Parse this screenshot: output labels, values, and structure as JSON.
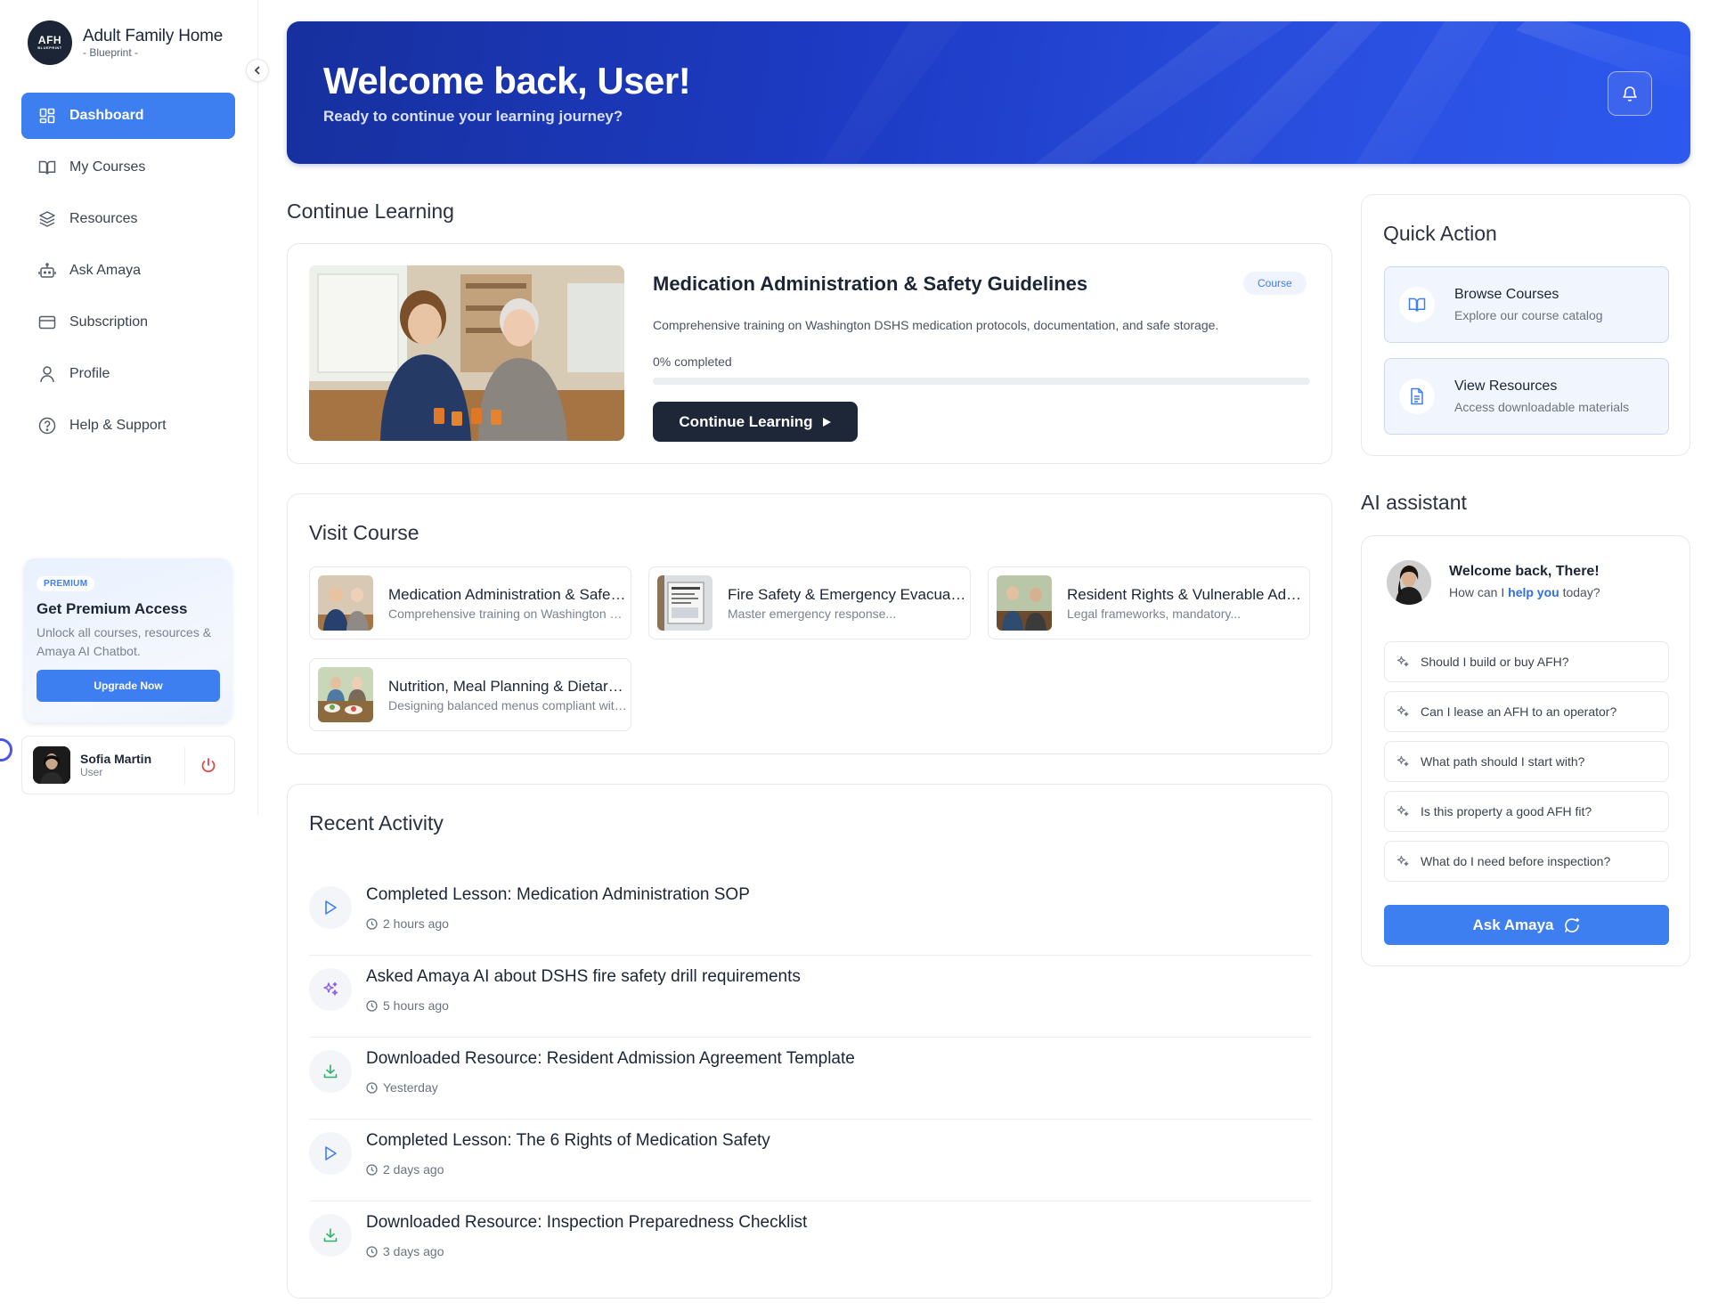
{
  "brand": {
    "logo_line1": "AFH",
    "logo_line2": "BLUEPRINT",
    "title": "Adult Family Home",
    "subtitle": "- Blueprint -"
  },
  "sidebar": {
    "items": [
      {
        "label": "Dashboard",
        "icon": "dashboard-icon",
        "active": true
      },
      {
        "label": "My Courses",
        "icon": "book-icon"
      },
      {
        "label": "Resources",
        "icon": "layers-icon"
      },
      {
        "label": "Ask Amaya",
        "icon": "bot-icon"
      },
      {
        "label": "Subscription",
        "icon": "card-icon"
      },
      {
        "label": "Profile",
        "icon": "user-icon"
      },
      {
        "label": "Help & Support",
        "icon": "help-icon"
      }
    ],
    "premium": {
      "tag": "PREMIUM",
      "title": "Get Premium Access",
      "desc": "Unlock all courses, resources & Amaya AI Chatbot.",
      "button": "Upgrade Now"
    },
    "user": {
      "name": "Sofia Martin",
      "role": "User"
    }
  },
  "hero": {
    "title": "Welcome back, User!",
    "subtitle": "Ready to continue your learning journey?"
  },
  "continue_learning": {
    "heading": "Continue Learning",
    "course_title": "Medication Administration & Safety Guidelines",
    "badge": "Course",
    "description": "Comprehensive training on Washington DSHS medication protocols, documentation, and safe storage.",
    "progress_label": "0% completed",
    "progress": 0,
    "button": "Continue Learning"
  },
  "visit_course": {
    "heading": "Visit Course",
    "items": [
      {
        "title": "Medication Administration & Safety Guidelines",
        "desc": "Comprehensive training on Washington DSHS medication protocols"
      },
      {
        "title": "Fire Safety & Emergency Evacuation",
        "desc": "Master emergency response..."
      },
      {
        "title": "Resident Rights & Vulnerable Adults",
        "desc": "Legal frameworks, mandatory..."
      },
      {
        "title": "Nutrition, Meal Planning & Dietary Needs",
        "desc": "Designing balanced menus compliant with state rules"
      }
    ]
  },
  "recent_activity": {
    "heading": "Recent Activity",
    "items": [
      {
        "title": "Completed Lesson: Medication Administration SOP",
        "time": "2 hours ago",
        "icon": "play-icon"
      },
      {
        "title": "Asked Amaya AI about DSHS fire safety drill requirements",
        "time": "5 hours ago",
        "icon": "sparkle-icon"
      },
      {
        "title": "Downloaded Resource: Resident Admission Agreement Template",
        "time": "Yesterday",
        "icon": "download-icon"
      },
      {
        "title": "Completed Lesson: The 6 Rights of Medication Safety",
        "time": "2 days ago",
        "icon": "play-icon"
      },
      {
        "title": "Downloaded Resource: Inspection Preparedness Checklist",
        "time": "3 days ago",
        "icon": "download-icon"
      }
    ]
  },
  "quick_action": {
    "heading": "Quick Action",
    "items": [
      {
        "title": "Browse Courses",
        "desc": "Explore our course catalog",
        "icon": "book-icon"
      },
      {
        "title": "View Resources",
        "desc": "Access downloadable materials",
        "icon": "document-icon"
      }
    ]
  },
  "ai_assistant": {
    "heading": "AI assistant",
    "welcome": "Welcome back, There!",
    "help_prefix": "How can I ",
    "help_highlight": "help you",
    "help_suffix": " today?",
    "questions": [
      "Should I build or buy AFH?",
      "Can I lease an AFH to an operator?",
      "What path should I start with?",
      "Is this property a good AFH fit?",
      "What do I need before inspection?"
    ],
    "button": "Ask Amaya"
  },
  "colors": {
    "accent": "#3d7ef0",
    "dark": "#1d2738",
    "hero": "#1d3bc4"
  }
}
